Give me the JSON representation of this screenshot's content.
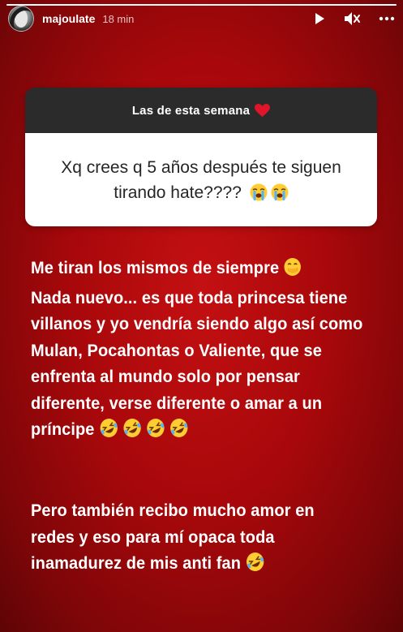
{
  "story": {
    "progress_fraction": 1.0,
    "username": "majoulate",
    "timestamp": "18 min",
    "icons": {
      "play": "play-icon",
      "mute": "muted-speaker-icon",
      "more": "more-options-icon"
    }
  },
  "question_sticker": {
    "header": "Las de esta semana",
    "header_emoji": "red-heart-emoji",
    "question_line1": "Xq crees q 5 años después te siguen",
    "question_line2": "tirando hate????"
  },
  "answer": {
    "line1": "Me tiran los mismos de siempre",
    "line2": "Nada nuevo... es que toda princesa tiene",
    "line3": "villanos y yo vendría siendo algo así como",
    "line4": "Mulan, Pocahontas o Valiente, que se",
    "line5": "enfrenta al mundo solo por pensar",
    "line6": "diferente, verse diferente o amar a un",
    "line7": "príncipe",
    "line8": "Pero también recibo mucho amor en",
    "line9": "redes y eso para mí opaca toda",
    "line10": "inamadurez de mis anti fan"
  },
  "colors": {
    "background": "#b00a0d",
    "card_header": "#2b2b2b",
    "card_body": "#ffffff",
    "emoji_yellow": "#ffcc33"
  }
}
